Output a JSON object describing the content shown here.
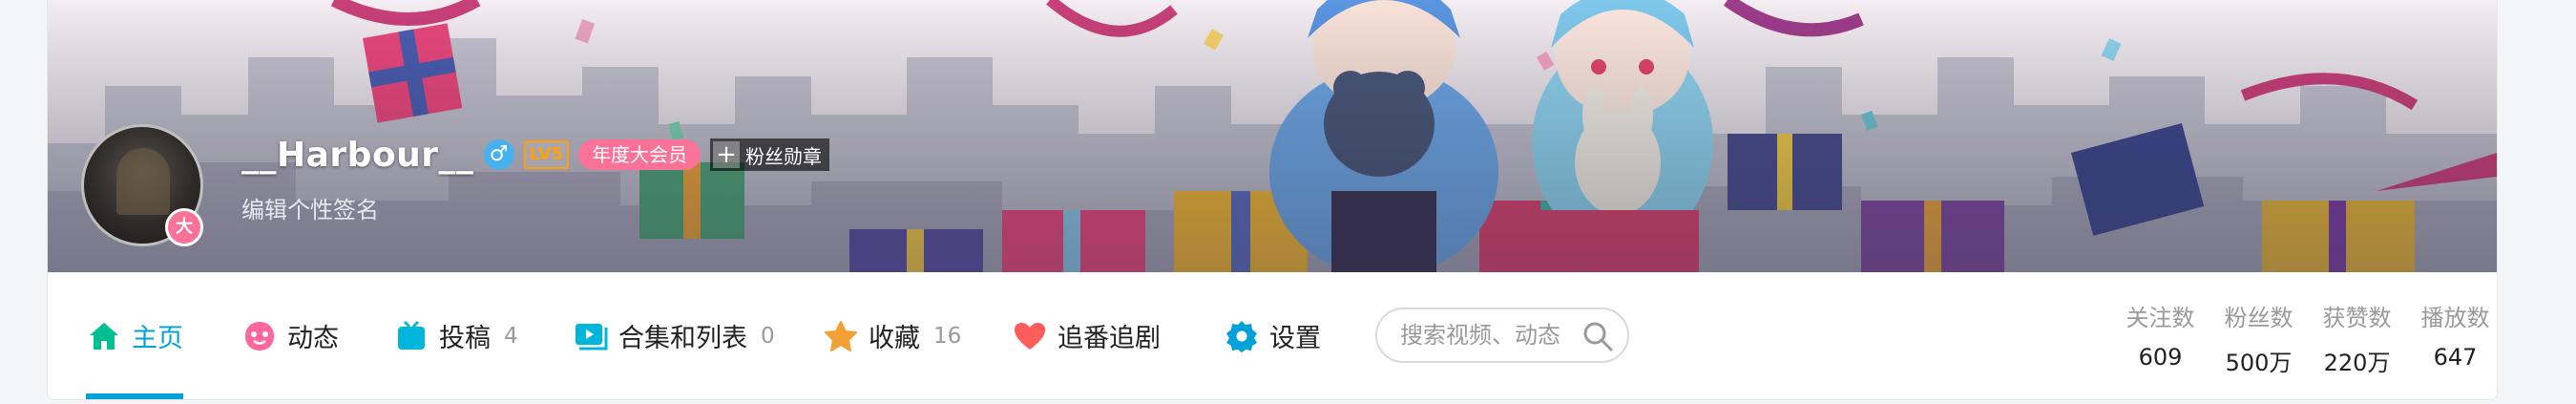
{
  "profile": {
    "username": "__Harbour__",
    "gender_symbol": "♂",
    "level": "LV5",
    "vip_label": "年度大会员",
    "medal_plus": "+",
    "medal_label": "粉丝勋章",
    "avatar_badge": "大",
    "signature": "编辑个性签名"
  },
  "nav": {
    "tabs": [
      {
        "label": "主页",
        "count": "",
        "icon": "home-icon",
        "color": "#00c091"
      },
      {
        "label": "动态",
        "count": "",
        "icon": "dynamic-icon",
        "color": "#ff6699"
      },
      {
        "label": "投稿",
        "count": "4",
        "icon": "tv-icon",
        "color": "#02b5da"
      },
      {
        "label": "合集和列表",
        "count": "0",
        "icon": "playlist-icon",
        "color": "#02b5da"
      },
      {
        "label": "收藏",
        "count": "16",
        "icon": "star-icon",
        "color": "#f3a034"
      },
      {
        "label": "追番追剧",
        "count": "",
        "icon": "heart-icon",
        "color": "#ff5c5c"
      },
      {
        "label": "设置",
        "count": "",
        "icon": "gear-icon",
        "color": "#00a1d6"
      }
    ],
    "active_color": "#00a1d6"
  },
  "search": {
    "placeholder": "搜索视频、动态",
    "icon": "search-icon"
  },
  "stats": [
    {
      "label": "关注数",
      "value": "609"
    },
    {
      "label": "粉丝数",
      "value": "500万"
    },
    {
      "label": "获赞数",
      "value": "220万"
    },
    {
      "label": "播放数",
      "value": "647"
    }
  ]
}
